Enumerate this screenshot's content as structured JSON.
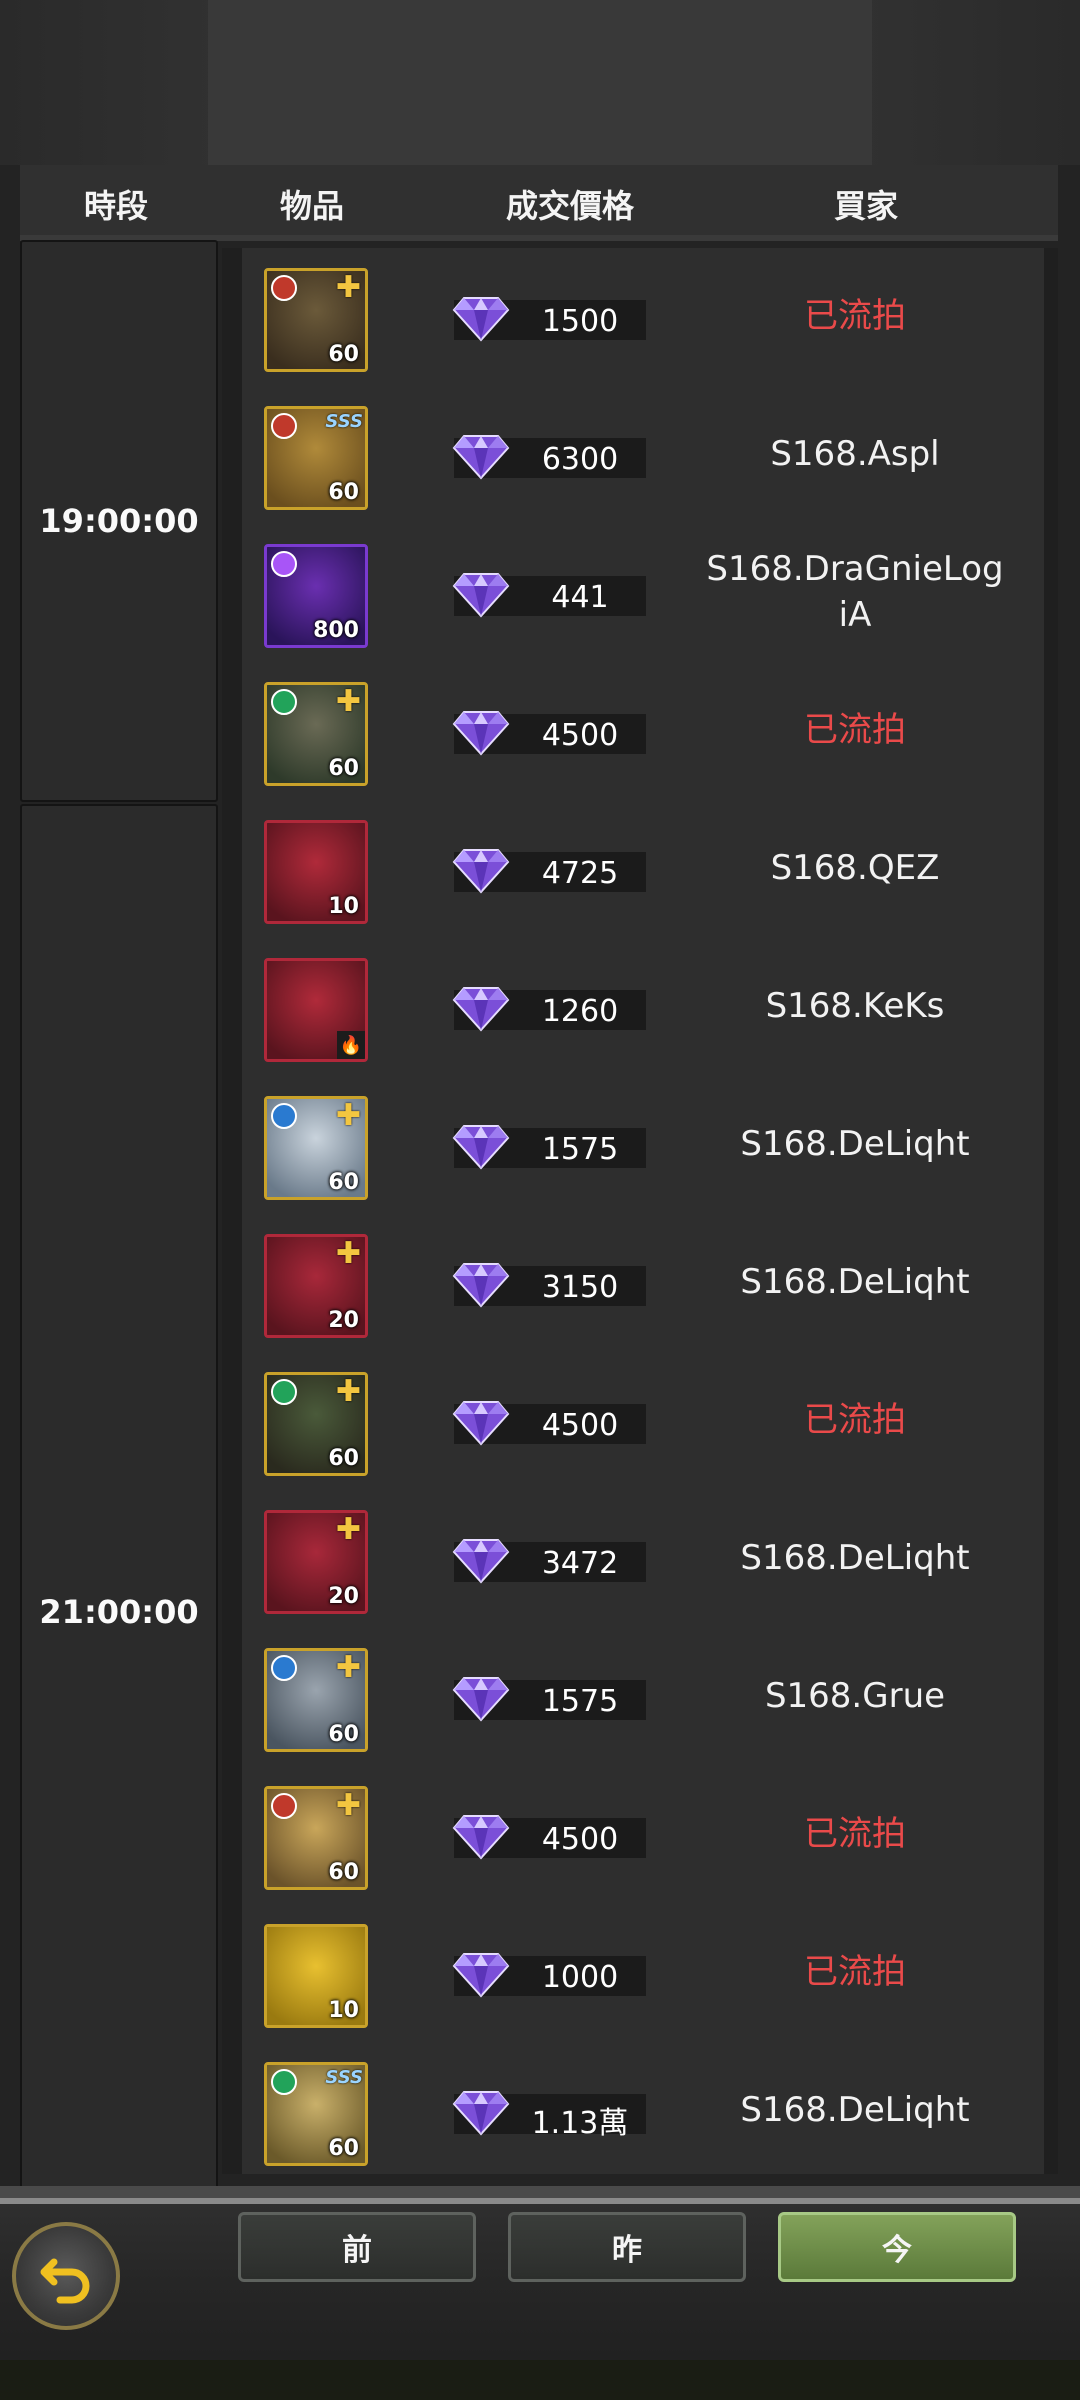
{
  "header": {
    "col_time": "時段",
    "col_item": "物品",
    "col_price": "成交價格",
    "col_buyer": "買家"
  },
  "time_slots": [
    {
      "label": "19:00:00"
    },
    {
      "label": "21:00:00"
    }
  ],
  "rows": [
    {
      "level": "60",
      "price": "1500",
      "buyer": "已流拍",
      "status": "unsold",
      "icon": "hero-orc-warrior-icon"
    },
    {
      "level": "60",
      "price": "6300",
      "buyer": "S168.Aspl",
      "status": "sold",
      "icon": "hero-monkey-king-icon"
    },
    {
      "level": "800",
      "price": "441",
      "buyer": "S168.DraGnieLogiA",
      "status": "sold",
      "icon": "purple-rune-stone-icon"
    },
    {
      "level": "60",
      "price": "4500",
      "buyer": "已流拍",
      "status": "unsold",
      "icon": "hero-elf-mage-icon"
    },
    {
      "level": "10",
      "price": "4725",
      "buyer": "S168.QEZ",
      "status": "sold",
      "icon": "ruby-amulet-icon"
    },
    {
      "level": "",
      "price": "1260",
      "buyer": "S168.KeKs",
      "status": "sold",
      "icon": "red-sash-icon"
    },
    {
      "level": "60",
      "price": "1575",
      "buyer": "S168.DeLiqht",
      "status": "sold",
      "icon": "hero-white-wolf-icon"
    },
    {
      "level": "20",
      "price": "3150",
      "buyer": "S168.DeLiqht",
      "status": "sold",
      "icon": "gold-ring-icon"
    },
    {
      "level": "60",
      "price": "4500",
      "buyer": "已流拍",
      "status": "unsold",
      "icon": "hero-hooded-ranger-icon"
    },
    {
      "level": "20",
      "price": "3472",
      "buyer": "S168.DeLiqht",
      "status": "sold",
      "icon": "gold-ring-icon"
    },
    {
      "level": "60",
      "price": "1575",
      "buyer": "S168.Grue",
      "status": "sold",
      "icon": "hero-masked-assassin-icon"
    },
    {
      "level": "60",
      "price": "4500",
      "buyer": "已流拍",
      "status": "unsold",
      "icon": "hero-golden-priestess-icon"
    },
    {
      "level": "10",
      "price": "1000",
      "buyer": "已流拍",
      "status": "unsold",
      "icon": "gold-emblem-icon"
    },
    {
      "level": "60",
      "price": "1.13萬",
      "buyer": "S168.DeLiqht",
      "status": "sold",
      "icon": "hero-blonde-warrior-icon"
    }
  ],
  "bottom_tabs": {
    "prev": "前",
    "yesterday": "昨",
    "today": "今",
    "active": "today"
  },
  "colors": {
    "unsold_text": "#ea4a4a",
    "active_tab": "#6f8f48",
    "gem": "#8b5cf6"
  }
}
